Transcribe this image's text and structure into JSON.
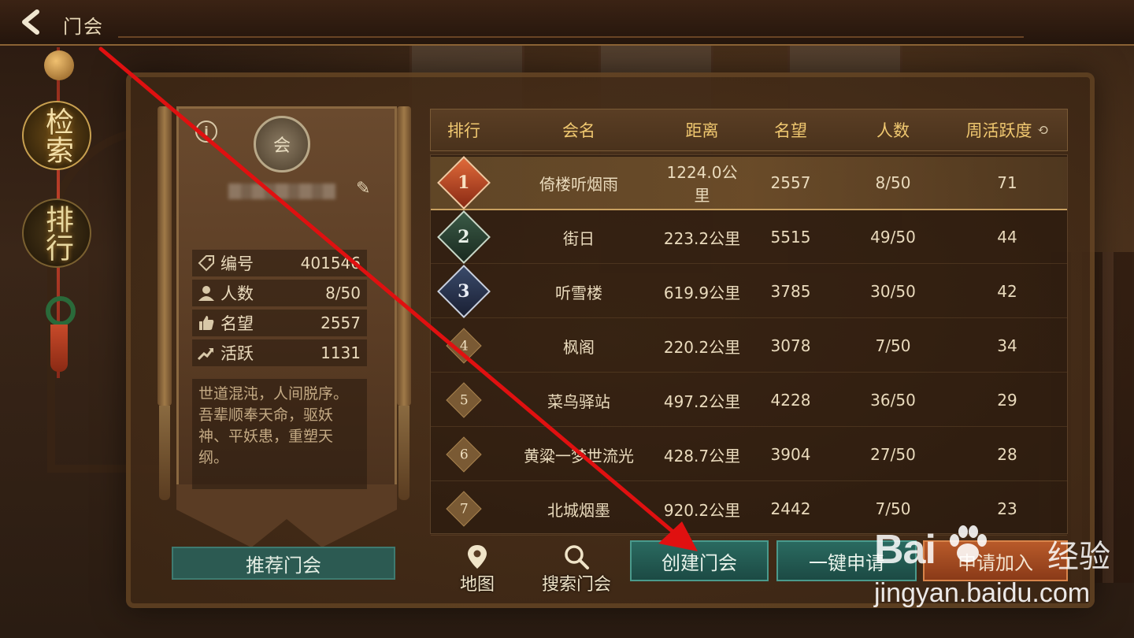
{
  "header": {
    "title": "门会"
  },
  "side_menu": [
    {
      "label": "检索",
      "active": true
    },
    {
      "label": "排行",
      "active": false
    }
  ],
  "guild": {
    "emblem_text": "会",
    "stats": [
      {
        "icon": "tag-icon",
        "label": "编号",
        "value": "401546"
      },
      {
        "icon": "person-icon",
        "label": "人数",
        "value": "8/50"
      },
      {
        "icon": "thumbs-up-icon",
        "label": "名望",
        "value": "2557"
      },
      {
        "icon": "trend-up-icon",
        "label": "活跃",
        "value": "1131"
      }
    ],
    "description": "世道混沌，人间脱序。吾辈顺奉天命，驱妖神、平妖患，重塑天纲。"
  },
  "table": {
    "headers": [
      "排行",
      "会名",
      "距离",
      "名望",
      "人数",
      "周活跃度"
    ],
    "rows": [
      {
        "rank": "1",
        "name": "倚楼听烟雨",
        "distance": "1224.0公里",
        "fame": "2557",
        "members": "8/50",
        "activity": "71"
      },
      {
        "rank": "2",
        "name": "街日",
        "distance": "223.2公里",
        "fame": "5515",
        "members": "49/50",
        "activity": "44"
      },
      {
        "rank": "3",
        "name": "听雪楼",
        "distance": "619.9公里",
        "fame": "3785",
        "members": "30/50",
        "activity": "42"
      },
      {
        "rank": "4",
        "name": "枫阁",
        "distance": "220.2公里",
        "fame": "3078",
        "members": "7/50",
        "activity": "34"
      },
      {
        "rank": "5",
        "name": "菜鸟驿站",
        "distance": "497.2公里",
        "fame": "4228",
        "members": "36/50",
        "activity": "29"
      },
      {
        "rank": "6",
        "name": "黄粱一梦世流光",
        "distance": "428.7公里",
        "fame": "3904",
        "members": "27/50",
        "activity": "28"
      },
      {
        "rank": "7",
        "name": "北城烟墨",
        "distance": "920.2公里",
        "fame": "2442",
        "members": "7/50",
        "activity": "23"
      }
    ]
  },
  "buttons": {
    "recommend": "推荐门会",
    "map": "地图",
    "search": "搜索门会",
    "create": "创建门会",
    "one_key_apply": "一键申请",
    "apply_join": "申请加入"
  },
  "watermark": {
    "logo": "Bai",
    "sub": "经验",
    "url": "jingyan.baidu.com"
  },
  "colors": {
    "accent_gold": "#f0c870",
    "teal_button": "#2a6a60",
    "orange_button": "#b85a2a",
    "annotation_red": "#e01010"
  }
}
